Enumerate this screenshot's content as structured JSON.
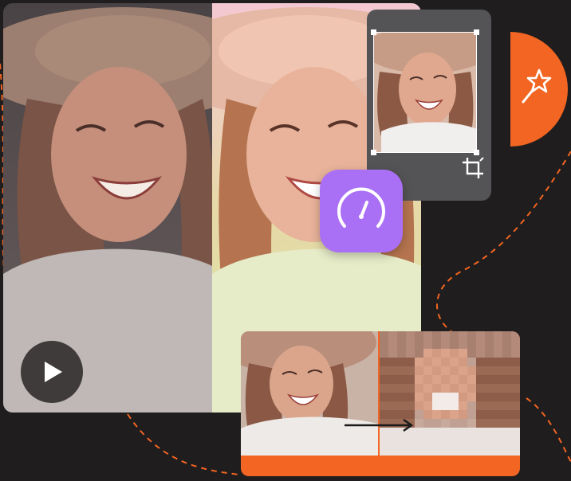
{
  "colors": {
    "background": "#1f1d1e",
    "accent_orange": "#f26522",
    "speed_purple": "#a970f5",
    "crop_panel": "#545356",
    "icon_white": "#ffffff"
  },
  "icons": {
    "play": "play-icon",
    "crop": "crop-icon",
    "speed": "speedometer-icon",
    "magic": "magic-wand-icon",
    "transform": "arrow-right-icon"
  }
}
